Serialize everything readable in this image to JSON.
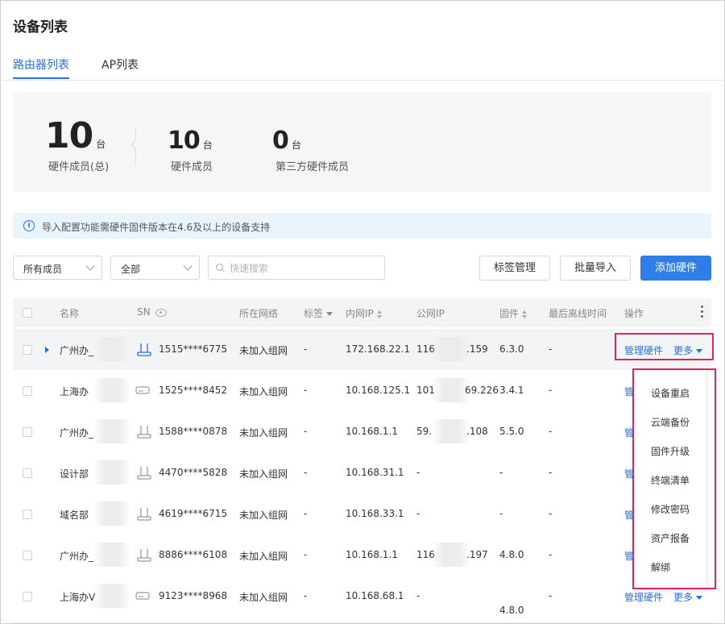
{
  "page": {
    "title": "设备列表"
  },
  "tabs": [
    {
      "label": "路由器列表",
      "active": true
    },
    {
      "label": "AP列表",
      "active": false
    }
  ],
  "stats": [
    {
      "value": "10",
      "unit": "台",
      "label": "硬件成员(总)"
    },
    {
      "value": "10",
      "unit": "台",
      "label": "硬件成员"
    },
    {
      "value": "0",
      "unit": "台",
      "label": "第三方硬件成员"
    }
  ],
  "notice": {
    "text": "导入配置功能需硬件固件版本在4.6及以上的设备支持"
  },
  "filters": {
    "member_select": "所有成员",
    "scope_select": "全部",
    "search_placeholder": "快速搜索"
  },
  "toolbar": {
    "tag_manage": "标签管理",
    "bulk_import": "批量导入",
    "add_hardware": "添加硬件"
  },
  "table": {
    "columns": {
      "name": "名称",
      "sn": "SN",
      "network": "所在网络",
      "tag": "标签",
      "lan_ip": "内网IP",
      "wan_ip": "公网IP",
      "firmware": "固件",
      "last_offline": "最后离线时间",
      "actions": "操作"
    },
    "rows": [
      {
        "name": "广州办_",
        "sn": "1515****6775",
        "network": "未加入组网",
        "tag": "-",
        "lan_ip": "172.168.22.1",
        "wan_ip": "116",
        "wan_ip_tail": ".159",
        "firmware": "6.3.0",
        "last_offline": "-",
        "manage": "管理硬件",
        "more": "更多",
        "device": "router"
      },
      {
        "name": "上海办",
        "sn": "1525****8452",
        "network": "未加入组网",
        "tag": "-",
        "lan_ip": "10.168.125.1",
        "wan_ip": "101",
        "wan_ip_tail": "69.226",
        "firmware": "3.4.1",
        "last_offline": "-",
        "manage": "管",
        "more": "",
        "device": "box"
      },
      {
        "name": "广州办_",
        "sn": "1588****0878",
        "network": "未加入组网",
        "tag": "-",
        "lan_ip": "10.168.1.1",
        "wan_ip": "59.",
        "wan_ip_tail": ".108",
        "firmware": "5.5.0",
        "last_offline": "-",
        "manage": "管",
        "more": "",
        "device": "router-gray"
      },
      {
        "name": "设计部",
        "sn": "4470****5828",
        "network": "未加入组网",
        "tag": "-",
        "lan_ip": "10.168.31.1",
        "wan_ip": "-",
        "wan_ip_tail": "",
        "firmware": "-",
        "last_offline": "-",
        "manage": "管",
        "more": "",
        "device": "router-gray"
      },
      {
        "name": "域名部",
        "sn": "4619****6715",
        "network": "未加入组网",
        "tag": "-",
        "lan_ip": "10.168.33.1",
        "wan_ip": "-",
        "wan_ip_tail": "",
        "firmware": "-",
        "last_offline": "-",
        "manage": "管",
        "more": "",
        "device": "router-gray"
      },
      {
        "name": "广州办_",
        "sn": "8886****6108",
        "network": "未加入组网",
        "tag": "-",
        "lan_ip": "10.168.1.1",
        "wan_ip": "116",
        "wan_ip_tail": ".197",
        "firmware": "4.8.0",
        "last_offline": "-",
        "manage": "管",
        "more": "",
        "device": "router-gray"
      },
      {
        "name": "上海办V",
        "sn": "9123****8968",
        "network": "未加入组网",
        "tag": "-",
        "lan_ip": "10.168.68.1",
        "wan_ip": "-",
        "wan_ip_tail": "",
        "firmware": "4.8.0",
        "last_offline": "-",
        "manage": "管理硬件",
        "more": "更多",
        "device": "box"
      }
    ]
  },
  "more_menu": [
    "设备重启",
    "云端备份",
    "固件升级",
    "终端清单",
    "修改密码",
    "资产报备",
    "解绑"
  ]
}
